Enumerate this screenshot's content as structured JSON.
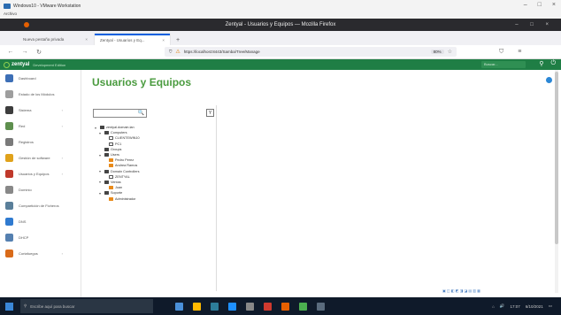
{
  "vm": {
    "title": "Windows10 - VMware Workstation",
    "menu": "Archivo"
  },
  "browser": {
    "window_title": "Zentyal - Usuarios y Equipos — Mozilla Firefox",
    "tabs": [
      {
        "label": "Nueva pestaña privada",
        "active": false
      },
      {
        "label": "Zentyal - Usuarios y Eq...",
        "active": true
      }
    ],
    "url": "https://localhost:8443/Samba/Tree/Manage",
    "zoom": "80%"
  },
  "app": {
    "brand": "zentyal",
    "brand_sub": "Development Edition",
    "search_placeholder": "Buscar...",
    "page_title": "Usuarios y Equipos",
    "sidebar": [
      {
        "icon": "dashboard-icon",
        "label": "Dashboard",
        "color": "#3d6fb6"
      },
      {
        "icon": "modules-icon",
        "label": "Estado de los Módulos",
        "color": "#9e9e9e"
      },
      {
        "icon": "system-icon",
        "label": "Sistema",
        "color": "#3d3d3d",
        "arrow": true
      },
      {
        "icon": "network-icon",
        "label": "Red",
        "color": "#5e8f4e",
        "arrow": true
      },
      {
        "icon": "logs-icon",
        "label": "Registros",
        "color": "#7a7a7a"
      },
      {
        "icon": "software-icon",
        "label": "Gestión de software",
        "color": "#e0a21b",
        "arrow": true
      },
      {
        "icon": "users-icon",
        "label": "Usuarios y Equipos",
        "color": "#c0392b",
        "arrow": true
      },
      {
        "icon": "domain-icon",
        "label": "Dominio",
        "color": "#888888"
      },
      {
        "icon": "shares-icon",
        "label": "Compartición de Ficheros",
        "color": "#5a7f9a"
      },
      {
        "icon": "dns-icon",
        "label": "DNS",
        "color": "#2f7ad0"
      },
      {
        "icon": "dhcp-icon",
        "label": "DHCP",
        "color": "#5580b0"
      },
      {
        "icon": "firewall-icon",
        "label": "Cortafuegos",
        "color": "#d96b1a",
        "arrow": true
      }
    ],
    "tree": [
      {
        "level": 0,
        "label": "zentyal.domain.lan",
        "icon": "dark",
        "twisty": "▾"
      },
      {
        "level": 1,
        "label": "Computers",
        "icon": "dark",
        "twisty": "▾"
      },
      {
        "level": 2,
        "label": "CLIENTEWIN10",
        "icon": "monitor",
        "twisty": ""
      },
      {
        "level": 2,
        "label": "PC1",
        "icon": "monitor",
        "twisty": ""
      },
      {
        "level": 1,
        "label": "Groups",
        "icon": "dark",
        "twisty": ""
      },
      {
        "level": 1,
        "label": "Users",
        "icon": "dark",
        "twisty": "▾"
      },
      {
        "level": 2,
        "label": "Pedro Perez",
        "icon": "orange",
        "twisty": ""
      },
      {
        "level": 2,
        "label": "Andrea Ramos",
        "icon": "orange",
        "twisty": ""
      },
      {
        "level": 1,
        "label": "Domain Controllers",
        "icon": "dark",
        "twisty": "▾"
      },
      {
        "level": 2,
        "label": "ZENTYAL",
        "icon": "monitor",
        "twisty": ""
      },
      {
        "level": 1,
        "label": "Ventas",
        "icon": "dark",
        "twisty": "▾"
      },
      {
        "level": 2,
        "label": "Juan",
        "icon": "orange",
        "twisty": ""
      },
      {
        "level": 1,
        "label": "Soporte",
        "icon": "dark",
        "twisty": "▾"
      },
      {
        "level": 2,
        "label": "Administrador",
        "icon": "orange",
        "twisty": ""
      }
    ]
  },
  "taskbar": {
    "search_placeholder": "Escribe aquí para buscar",
    "time": "17:07",
    "date": "6/10/2021",
    "apps": [
      "#4a90d9",
      "#ffb900",
      "#2d7d9a",
      "#1e90ff",
      "#888",
      "#d03a2f",
      "#e66000",
      "#4caf50",
      "#5a6b7d"
    ]
  }
}
